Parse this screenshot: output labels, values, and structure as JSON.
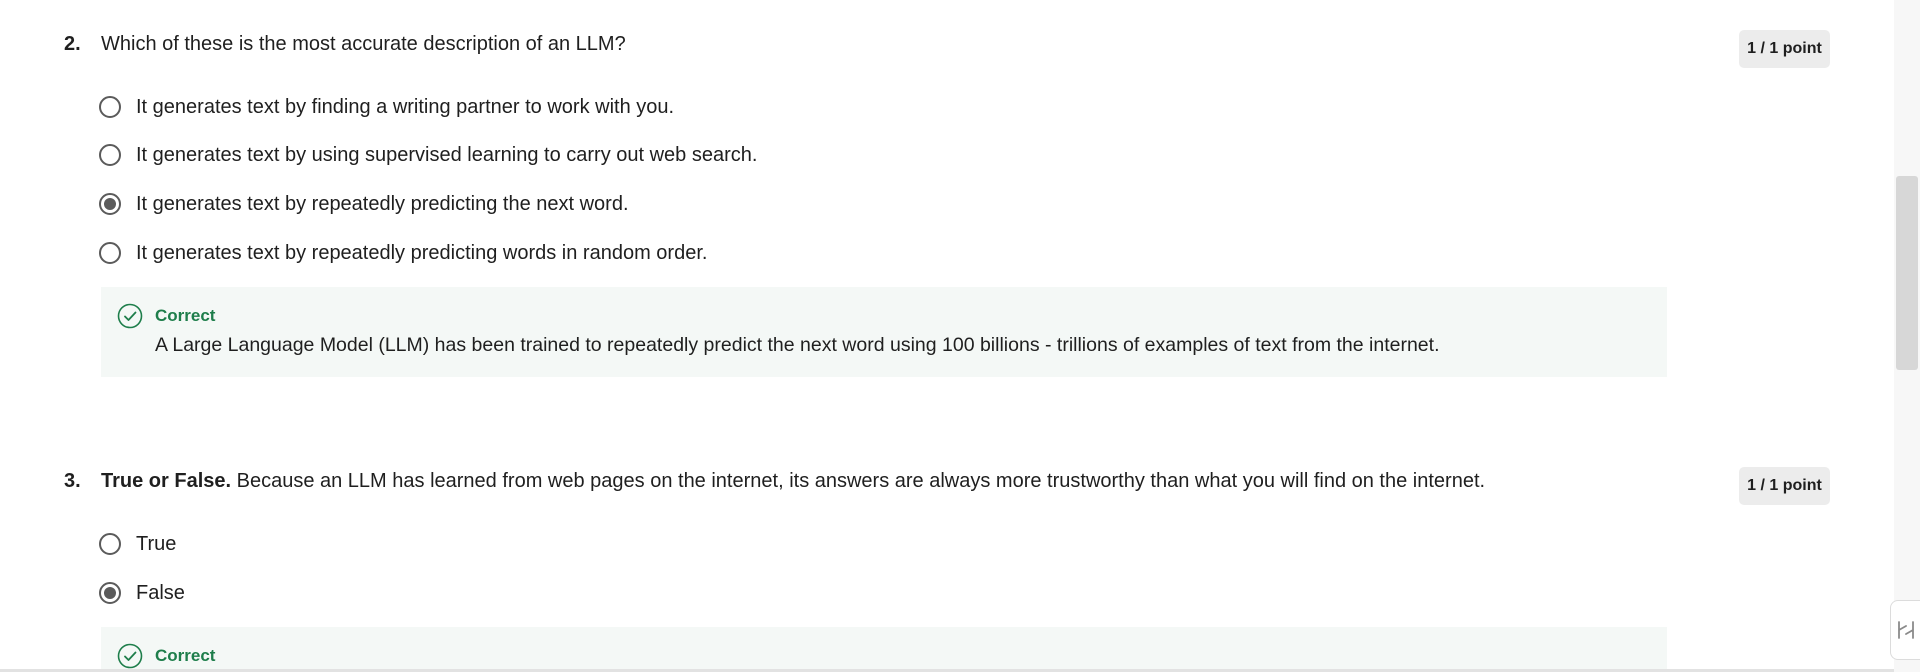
{
  "q2": {
    "number": "2.",
    "text": "Which of these is the most accurate description of an LLM?",
    "points": "1 / 1 point",
    "options": [
      {
        "label": "It generates text by finding a writing partner to work with you.",
        "selected": false
      },
      {
        "label": "It generates text by using supervised learning to carry out web search.",
        "selected": false
      },
      {
        "label": "It generates text by repeatedly predicting the next word.",
        "selected": true
      },
      {
        "label": "It generates text by repeatedly predicting words in random order.",
        "selected": false
      }
    ],
    "feedback": {
      "title": "Correct",
      "text": "A Large Language Model (LLM) has been trained to repeatedly predict the next word using 100 billions - trillions of examples of text from the internet."
    }
  },
  "q3": {
    "number": "3.",
    "text_bold": "True or False.",
    "text": " Because an LLM has learned from web pages on the internet, its answers are always more trustworthy than what you will find on the internet.",
    "points": "1 / 1 point",
    "options": [
      {
        "label": "True",
        "selected": false
      },
      {
        "label": "False",
        "selected": true
      }
    ],
    "feedback": {
      "title": "Correct"
    }
  },
  "colors": {
    "correct": "#1e7e4b",
    "feedback_bg": "#f4f8f6",
    "radio": "#5b5b5b"
  },
  "icons": {
    "feedback": "check-circle-icon",
    "corner_widget": "feedback-widget-icon"
  }
}
